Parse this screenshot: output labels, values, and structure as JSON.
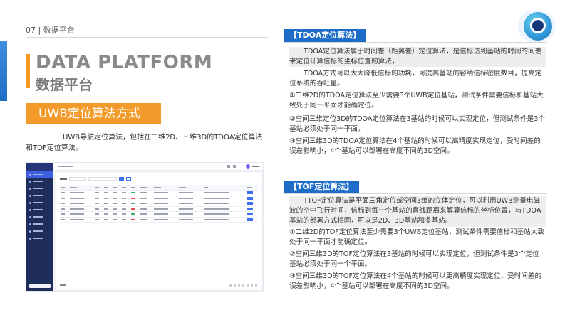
{
  "page_header": "07 | 数据平台",
  "title_en": "DATA PLATFORM",
  "title_cn": "数据平台",
  "section_tag": "UWB定位算法方式",
  "intro": "UWB导航定位算法，包括在二维2D、三维3D的TDOA定位算法和TOF定位算法。",
  "tdoa": {
    "tag": "【TDOA定位算法】",
    "p1": "TDOA定位算法属于时间差（距离差）定位算法，是信标达到基站的时间的间差来定位计算信标的坐标位置的算法，",
    "p2": "TDOA方式可以大大降低信标的功耗，可提高基站的容纳信标密度数目，提高定位系统的吞吐量。",
    "p3": "①二维2D的TDOA定位算法至少需要3个UWB定位基站，测试条件需要信标和基站大致处于同一平面才能确定位。",
    "p4": "②空间三维定位3D的TDOA定位算法在3基站的时候可以实现定位，但测试条件是3个基站必须处于同一平面。",
    "p5": "③空间三维3D的TDOA定位算法在4个基站的时候可以高精度实现定位，受时间差的误差影响小，4个基站可以部署在高度不同的3D空间。"
  },
  "tof": {
    "tag": "【TOF定位算法】",
    "p1": "TTOF定位算法是平面三角定位或空间3维的立体定位，可以利用UWB测量电磁波的空中飞行时间，信标到每一个基站的直线距离来解算信标的坐标位置，与TDOA基站的部署方式相同，可以是2D、3D基站和多基站。",
    "p2": "①二维2D的TOF定位算法至少需要3个UWB定位基站，测试条件需要信标和基站大致处于同一平面才能确定位。",
    "p3": "②空间三维3D的TOF定位算法在3基站的时候可以实现定位，但测试条件是3个定位基站必须处于同一个平面。",
    "p4": "③空间三维3D的TOF定位算法在4个基站的时候可以更高精度实现定位，受时间差的误差影响小，4个基站可以部署在高度不同的3D空间。"
  },
  "colors": {
    "accent_orange": "#f39b2a",
    "accent_blue": "#1d6cc7"
  }
}
